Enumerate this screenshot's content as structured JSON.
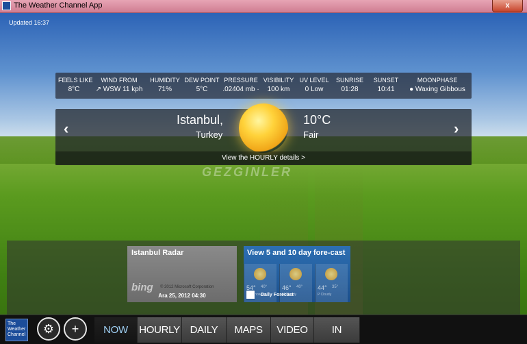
{
  "window": {
    "title": "The Weather Channel App",
    "close_label": "x"
  },
  "updated": "Updated 16:37",
  "stats": [
    {
      "label": "FEELS LIKE",
      "value": "8°C"
    },
    {
      "label": "WIND FROM",
      "value": "↗ WSW 11 kph"
    },
    {
      "label": "HUMIDITY",
      "value": "71%"
    },
    {
      "label": "DEW POINT",
      "value": "5°C"
    },
    {
      "label": "PRESSURE",
      "value": ".02404 mb ·"
    },
    {
      "label": "VISIBILITY",
      "value": "100 km"
    },
    {
      "label": "UV LEVEL",
      "value": "0 Low"
    },
    {
      "label": "SUNRISE",
      "value": "01:28"
    },
    {
      "label": "SUNSET",
      "value": "10:41"
    },
    {
      "label": "MOONPHASE",
      "value": "● Waxing Gibbous"
    }
  ],
  "location": {
    "city": "Istanbul,",
    "country": "Turkey",
    "temperature": "10°C",
    "condition": "Fair",
    "hourly_link": "View the HOURLY details >"
  },
  "watermark": "GEZGINLER",
  "tiles": {
    "radar": {
      "title": "Istanbul Radar",
      "bing": "bing",
      "copyright": "© 2012 Microsoft Corporation",
      "date": "Ara 25, 2012 04:30"
    },
    "forecast": {
      "title": "View 5 and 10 day fore-cast",
      "label": "Daily Forecast",
      "days": [
        {
          "hi": "54°",
          "lo": "40°",
          "cond": "AM Showers"
        },
        {
          "hi": "46°",
          "lo": "40°",
          "cond": "M Cloudy"
        },
        {
          "hi": "44°",
          "lo": "35°",
          "cond": "P Cloudy"
        }
      ]
    }
  },
  "nav": {
    "logo": "The Weather Channel",
    "settings_icon": "⚙",
    "location_icon": "+",
    "tabs": [
      {
        "label": "NOW",
        "active": true
      },
      {
        "label": "HOURLY",
        "active": false
      },
      {
        "label": "DAILY",
        "active": false
      },
      {
        "label": "MAPS",
        "active": false
      },
      {
        "label": "VIDEO",
        "active": false
      },
      {
        "label": "IN SEASON",
        "active": false
      }
    ]
  },
  "colors": {
    "active_tab": "#9fd0f5",
    "titlebar": "#cf7d92",
    "logo": "#1c4d9a"
  }
}
